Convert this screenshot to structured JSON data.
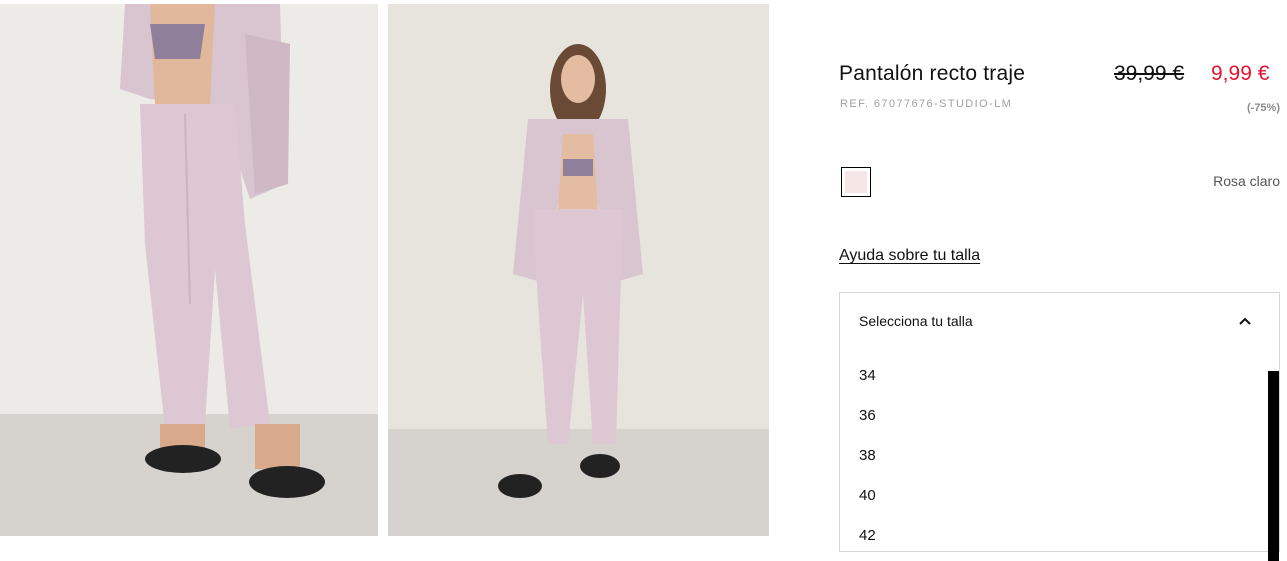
{
  "product": {
    "title": "Pantalón recto traje",
    "ref": "REF. 67077676-STUDIO-LM",
    "old_price": "39,99 €",
    "new_price": "9,99 €",
    "discount": "(-75%)"
  },
  "color": {
    "name": "Rosa claro",
    "swatch_hex": "#f6e7e6"
  },
  "size_help": "Ayuda sobre tu talla",
  "size_selector": {
    "header": "Selecciona tu talla",
    "options": [
      "34",
      "36",
      "38",
      "40",
      "42"
    ]
  },
  "icons": {
    "chevron": "chevron-up-icon"
  },
  "colors": {
    "sale_red": "#e5132e",
    "suit_pink": "#dcc7d2"
  }
}
